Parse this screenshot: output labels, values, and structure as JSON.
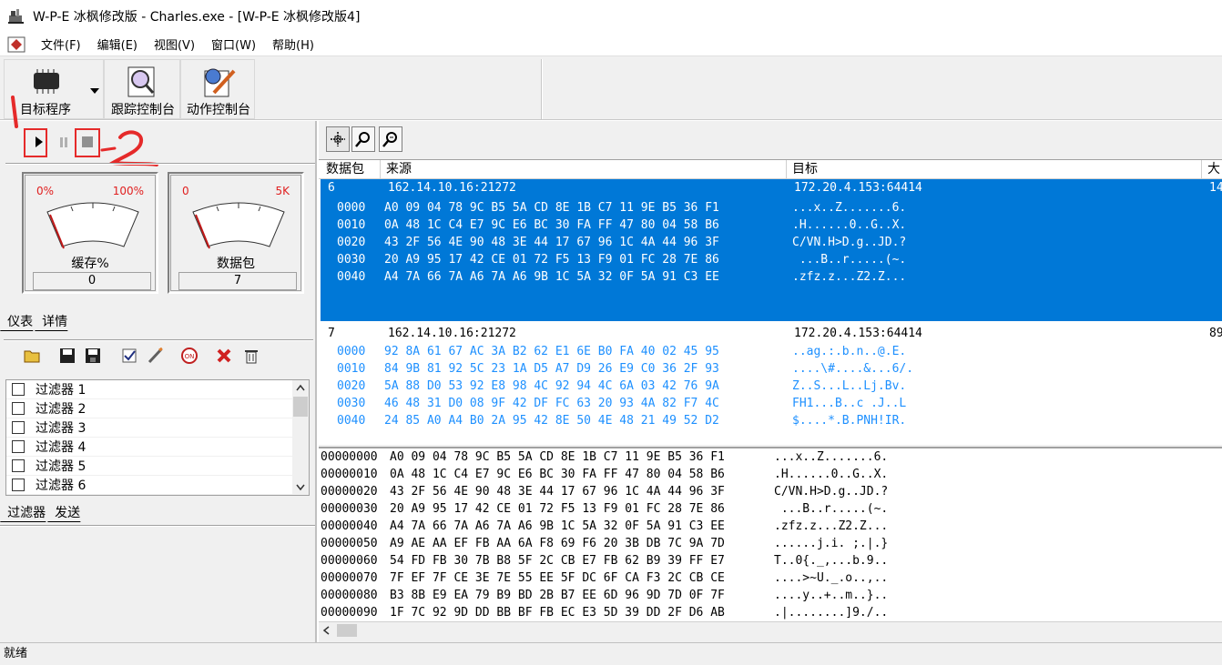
{
  "window": {
    "title": "W-P-E 冰枫修改版 - Charles.exe - [W-P-E 冰枫修改版4]"
  },
  "menu": [
    "文件(F)",
    "编辑(E)",
    "视图(V)",
    "窗口(W)",
    "帮助(H)"
  ],
  "toolbar": {
    "target_label": "目标程序",
    "trace_label": "跟踪控制台",
    "action_label": "动作控制台"
  },
  "gauges": {
    "buffer": {
      "min": "0%",
      "max": "100%",
      "label": "缓存%",
      "value": "0",
      "level": 0.0
    },
    "packets": {
      "min": "0",
      "max": "5K",
      "label": "数据包",
      "value": "7",
      "level": 0.0
    }
  },
  "tabs_top": [
    "仪表",
    "详情"
  ],
  "filters": [
    "过滤器 1",
    "过滤器 2",
    "过滤器 3",
    "过滤器 4",
    "过滤器 5",
    "过滤器 6"
  ],
  "tabs_bottom": [
    "过滤器",
    "发送"
  ],
  "columns": [
    "数据包",
    "来源",
    "目标",
    "大"
  ],
  "packets": [
    {
      "id": "6",
      "source": "162.14.10.16:21272",
      "target": "172.20.4.153:64414",
      "size": "14",
      "selected": true,
      "rows": [
        {
          "off": "0000",
          "hex": "A0 09 04 78 9C B5 5A CD 8E 1B C7 11 9E B5 36 F1",
          "ascii": "...x..Z.......6."
        },
        {
          "off": "0010",
          "hex": "0A 48 1C C4 E7 9C E6 BC 30 FA FF 47 80 04 58 B6",
          "ascii": ".H......0..G..X."
        },
        {
          "off": "0020",
          "hex": "43 2F 56 4E 90 48 3E 44 17 67 96 1C 4A 44 96 3F",
          "ascii": "C/VN.H>D.g..JD.?"
        },
        {
          "off": "0030",
          "hex": "20 A9 95 17 42 CE 01 72 F5 13 F9 01 FC 28 7E 86",
          "ascii": " ...B..r.....(~."
        },
        {
          "off": "0040",
          "hex": "A4 7A 66 7A A6 7A A6 9B 1C 5A 32 0F 5A 91 C3 EE",
          "ascii": ".zfz.z...Z2.Z..."
        }
      ]
    },
    {
      "id": "7",
      "source": "162.14.10.16:21272",
      "target": "172.20.4.153:64414",
      "size": "89",
      "selected": false,
      "rows": [
        {
          "off": "0000",
          "hex": "92 8A 61 67 AC 3A B2 62 E1 6E B0 FA 40 02 45 95",
          "ascii": "..ag.:.b.n..@.E."
        },
        {
          "off": "0010",
          "hex": "84 9B 81 92 5C 23 1A D5 A7 D9 26 E9 C0 36 2F 93",
          "ascii": "....\\#....&...6/."
        },
        {
          "off": "0020",
          "hex": "5A 88 D0 53 92 E8 98 4C 92 94 4C 6A 03 42 76 9A",
          "ascii": "Z..S...L..Lj.Bv."
        },
        {
          "off": "0030",
          "hex": "46 48 31 D0 08 9F 42 DF FC 63 20 93 4A 82 F7 4C",
          "ascii": "FH1...B..c .J..L"
        },
        {
          "off": "0040",
          "hex": "24 85 A0 A4 B0 2A 95 42 8E 50 4E 48 21 49 52 D2",
          "ascii": "$....*.B.PNH!IR."
        }
      ]
    }
  ],
  "hexdump": [
    {
      "off": "00000000",
      "hex": "A0 09 04 78 9C B5 5A CD 8E 1B C7 11 9E B5 36 F1",
      "ascii": "...x..Z.......6."
    },
    {
      "off": "00000010",
      "hex": "0A 48 1C C4 E7 9C E6 BC 30 FA FF 47 80 04 58 B6",
      "ascii": ".H......0..G..X."
    },
    {
      "off": "00000020",
      "hex": "43 2F 56 4E 90 48 3E 44 17 67 96 1C 4A 44 96 3F",
      "ascii": "C/VN.H>D.g..JD.?"
    },
    {
      "off": "00000030",
      "hex": "20 A9 95 17 42 CE 01 72 F5 13 F9 01 FC 28 7E 86",
      "ascii": " ...B..r.....(~."
    },
    {
      "off": "00000040",
      "hex": "A4 7A 66 7A A6 7A A6 9B 1C 5A 32 0F 5A 91 C3 EE",
      "ascii": ".zfz.z...Z2.Z..."
    },
    {
      "off": "00000050",
      "hex": "A9 AE AA EF FB AA 6A F8 69 F6 20 3B DB 7C 9A 7D",
      "ascii": "......j.i. ;.|.}"
    },
    {
      "off": "00000060",
      "hex": "54 FD FB 30 7B B8 5F 2C CB E7 FB 62 B9 39 FF E7",
      "ascii": "T..0{._,...b.9.."
    },
    {
      "off": "00000070",
      "hex": "7F EF 7F CE 3E 7E 55 EE 5F DC 6F CA F3 2C CB CE",
      "ascii": "....>~U._.o..,.."
    },
    {
      "off": "00000080",
      "hex": "B3 8B E9 EA 79 B9 BD 2B B7 EE 6D 96 9D 7D 0F 7F",
      "ascii": "....y..+..m..}.."
    },
    {
      "off": "00000090",
      "hex": "1F 7C 92 9D DD BB BF FB EC E3 5D 39 DD 2F D6 AB",
      "ascii": ".|........]9./.."
    }
  ],
  "status": "就绪",
  "annotations": [
    "1",
    "2"
  ],
  "colors": {
    "selection": "#0078d7",
    "gauge_red": "#e02020",
    "annotation": "#e52a2a",
    "hex_blue": "#1e90ff"
  }
}
